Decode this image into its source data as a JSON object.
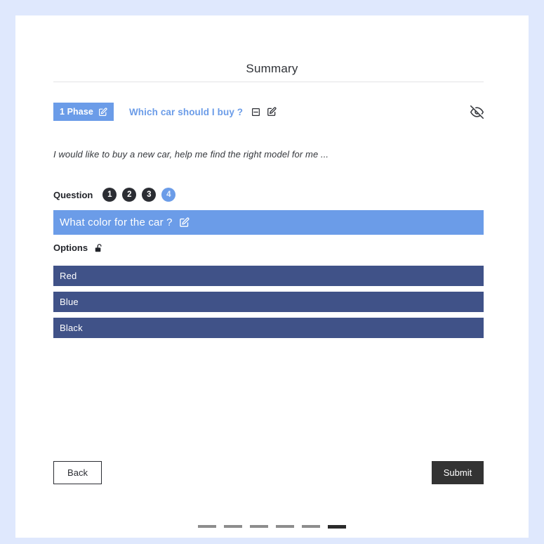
{
  "page": {
    "title": "Summary",
    "background_color": "#dfe8fd",
    "card_color": "#ffffff"
  },
  "colors": {
    "accent_blue": "#6b9ce8",
    "option_navy": "#405288",
    "dark": "#2b2d33",
    "submit": "#333333"
  },
  "phase": {
    "badge_label": "1 Phase",
    "badge_edit_icon": "edit-icon",
    "name": "Which car should I buy ?",
    "collapse_icon": "minus-square-icon",
    "edit_icon": "edit-icon",
    "visibility_icon": "eye-off-icon"
  },
  "description": "I would like to buy a new car, help me find the right model for me ...",
  "question_nav": {
    "label": "Question",
    "items": [
      {
        "number": "1",
        "active": false
      },
      {
        "number": "2",
        "active": false
      },
      {
        "number": "3",
        "active": false
      },
      {
        "number": "4",
        "active": true
      }
    ]
  },
  "question": {
    "text": "What color for the car ?",
    "edit_icon": "edit-icon"
  },
  "options": {
    "label": "Options",
    "lock_icon": "unlock-icon",
    "items": [
      {
        "label": "Red"
      },
      {
        "label": "Blue"
      },
      {
        "label": "Black"
      }
    ]
  },
  "footer": {
    "back_label": "Back",
    "submit_label": "Submit"
  },
  "pagination": {
    "total": 6,
    "active_index": 5
  }
}
